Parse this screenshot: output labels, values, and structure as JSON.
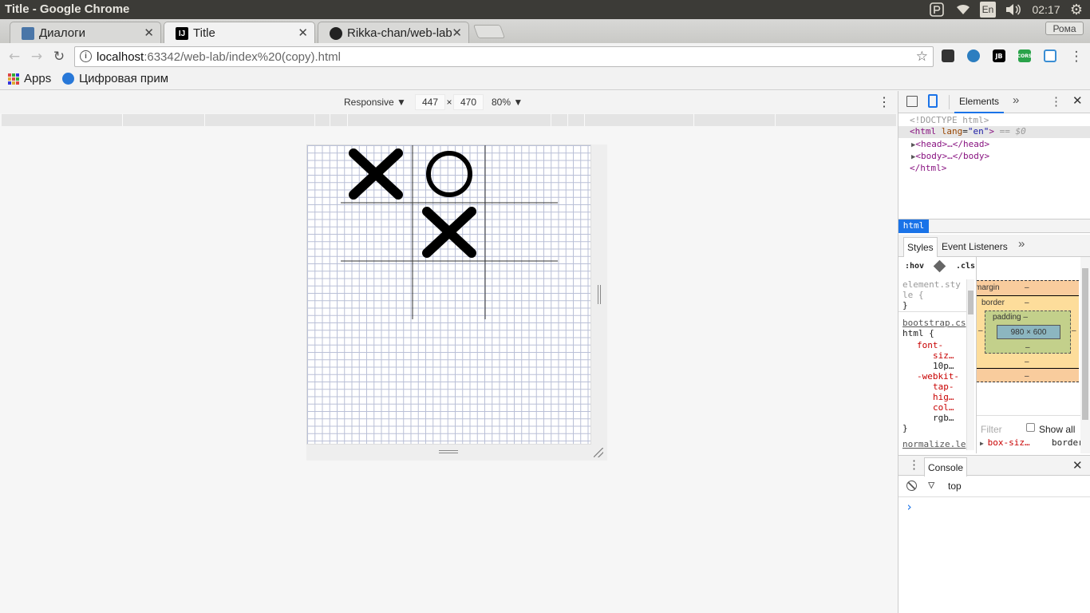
{
  "os_bar": {
    "window_title": "Title - Google Chrome",
    "keyboard_layout": "En",
    "clock": "02:17"
  },
  "tabs": [
    {
      "label": "Диалоги",
      "favicon": "vk-icon",
      "active": false
    },
    {
      "label": "Title",
      "favicon": "jetbrains-icon",
      "active": true
    },
    {
      "label": "Rikka-chan/web-lab",
      "favicon": "github-icon",
      "active": false
    }
  ],
  "profile": {
    "name": "Рома"
  },
  "omnibox": {
    "host": "localhost",
    "path": ":63342/web-lab/index%20(copy).html"
  },
  "bookmarks": [
    {
      "label": "Apps",
      "icon": "apps-grid-icon"
    },
    {
      "label": "Цифровая прим",
      "icon": "bookmark-favicon"
    }
  ],
  "device_toolbar": {
    "mode": "Responsive",
    "width": "447",
    "times": "×",
    "height": "470",
    "zoom": "80%"
  },
  "game_board": {
    "cells": [
      "X",
      "O",
      "",
      "",
      "X",
      "",
      "",
      "",
      ""
    ],
    "colors": {
      "mark": "#000000",
      "grid": "#b8bfd6",
      "board_lines": "#333333"
    }
  },
  "devtools": {
    "top_tab": "Elements",
    "dom": {
      "doctype": "<!DOCTYPE html>",
      "html_open": "<html",
      "lang_attr": "lang",
      "lang_value": "\"en\"",
      "eq": ">",
      "dollar": "== $0",
      "head": "<head>…</head>",
      "body": "<body>…</body>",
      "html_close": "</html>"
    },
    "breadcrumb": "html",
    "styles_tabs": [
      "Styles",
      "Event Listeners"
    ],
    "filter_controls": {
      "hov": ":hov",
      "cls": ".cls"
    },
    "rules": {
      "element_style_1": "element.sty",
      "element_style_2": "le {",
      "close": "}",
      "bootstrap_src": "bootstrap.cs",
      "html_sel": "html {",
      "font_prop_1": "font-",
      "font_prop_2": "siz…",
      "font_val": "10p…",
      "tap_prop_1": "-webkit-",
      "tap_prop_2": "tap-",
      "tap_prop_3": "hig…",
      "tap_prop_4": "col…",
      "tap_val": "rgb…",
      "normalize_src": "normalize.le"
    },
    "box_model": {
      "margin": "margin",
      "border": "border",
      "padding": "padding",
      "dash": "–",
      "content": "980 × 600"
    },
    "computed": {
      "filter_placeholder": "Filter",
      "show_all": "Show all",
      "prop": "box-siz…",
      "value": "border"
    },
    "console": {
      "tab": "Console",
      "context": "top",
      "prompt": "›"
    }
  }
}
